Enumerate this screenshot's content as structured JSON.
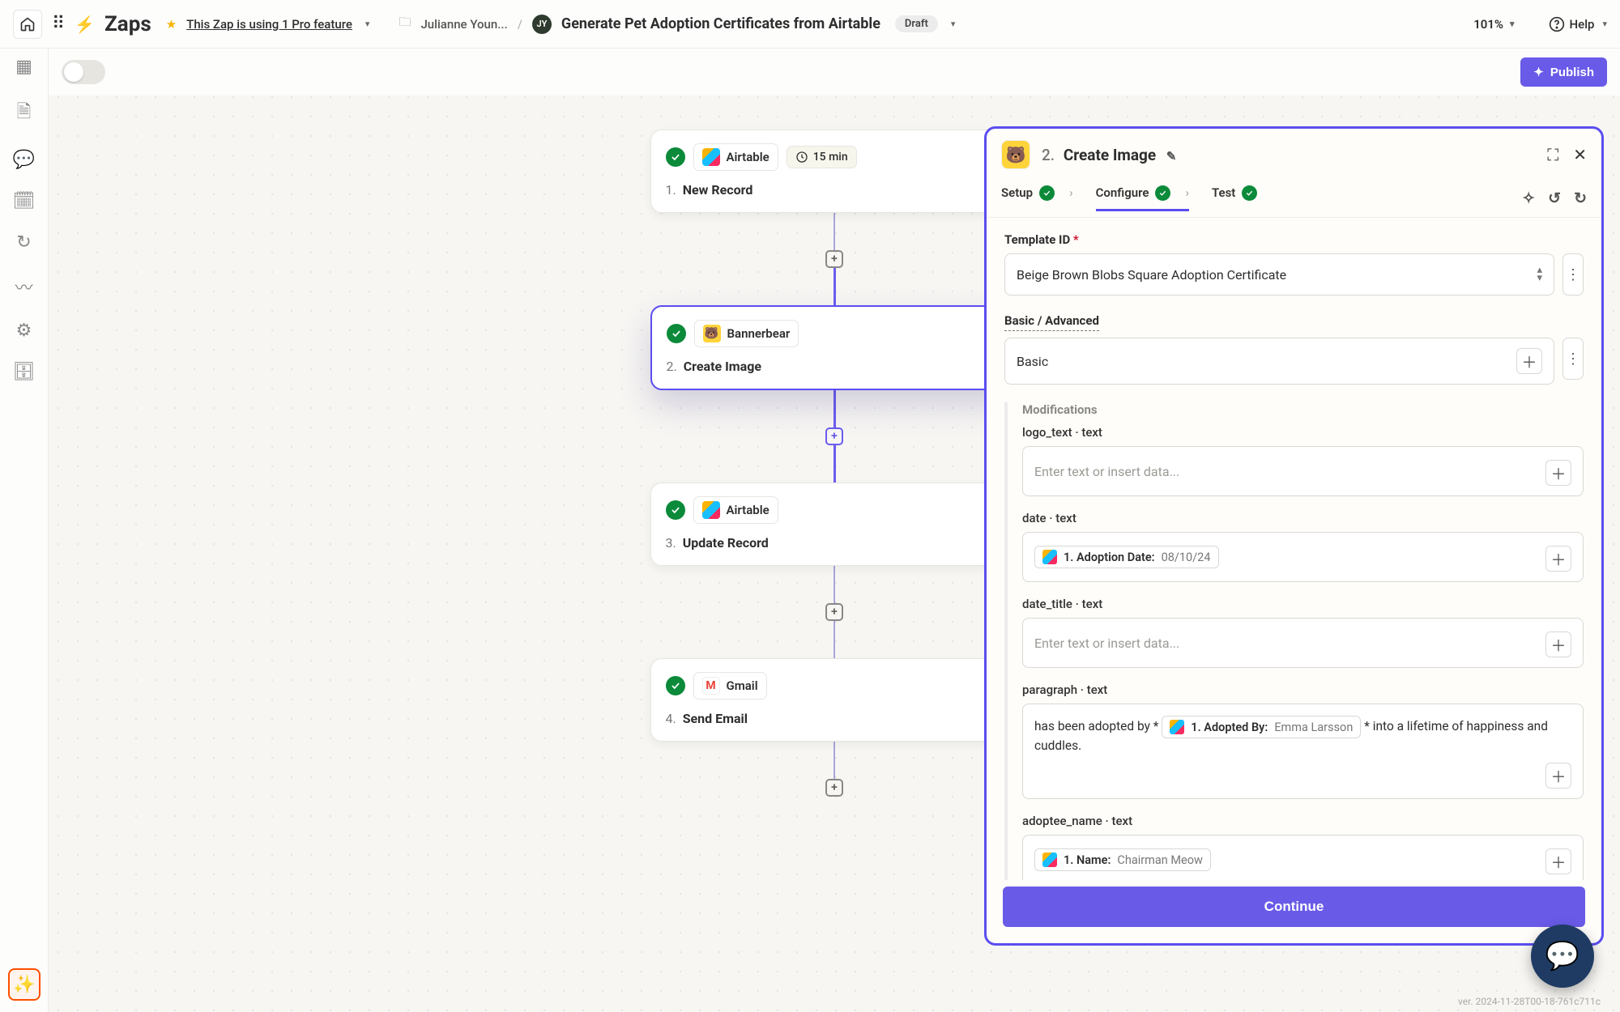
{
  "top": {
    "app_label": "Zaps",
    "pro_text": "This Zap is using 1 Pro feature",
    "breadcrumb_folder": "Julianne Youn...",
    "avatar_initials": "JY",
    "zap_title": "Generate Pet Adoption Certificates from Airtable",
    "draft_badge": "Draft",
    "zoom": "101%",
    "help": "Help"
  },
  "publish_label": "Publish",
  "flow": {
    "nodes": [
      {
        "app": "Airtable",
        "interval": "15 min",
        "num": "1.",
        "title": "New Record",
        "app_style": "airtable"
      },
      {
        "app": "Bannerbear",
        "num": "2.",
        "title": "Create Image",
        "app_style": "bb",
        "selected": true
      },
      {
        "app": "Airtable",
        "num": "3.",
        "title": "Update Record",
        "app_style": "airtable"
      },
      {
        "app": "Gmail",
        "num": "4.",
        "title": "Send Email",
        "app_style": "gmail"
      }
    ]
  },
  "panel": {
    "head_num": "2.",
    "head_title": "Create Image",
    "tabs": {
      "setup": "Setup",
      "configure": "Configure",
      "test": "Test"
    },
    "template": {
      "label": "Template ID",
      "value": "Beige Brown Blobs Square Adoption Certificate"
    },
    "basic_adv": {
      "label": "Basic / Advanced",
      "value": "Basic"
    },
    "mods_label": "Modifications",
    "placeholder_text": "Enter text or insert data...",
    "fields": {
      "logo": {
        "label": "logo_text · text"
      },
      "date": {
        "label": "date · text",
        "pill_label": "1. Adoption Date:",
        "pill_value": "08/10/24"
      },
      "date_title": {
        "label": "date_title · text"
      },
      "paragraph": {
        "label": "paragraph · text",
        "pre": "has been adopted by *",
        "pill_label": "1. Adopted By:",
        "pill_value": "Emma Larsson",
        "post": "* into a lifetime of happiness and cuddles."
      },
      "adoptee": {
        "label": "adoptee_name · text",
        "pill_label": "1. Name:",
        "pill_value": "Chairman Meow"
      }
    },
    "continue": "Continue"
  },
  "version": "ver. 2024-11-28T00-18-761c711c"
}
